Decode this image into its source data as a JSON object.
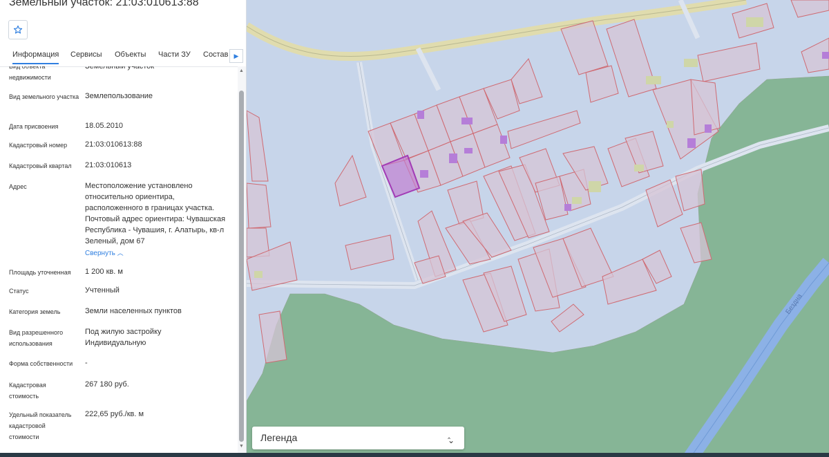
{
  "header": {
    "title": "Земельный участок: 21:03:010613:88"
  },
  "tabs": [
    {
      "label": "Информация",
      "active": true
    },
    {
      "label": "Сервисы"
    },
    {
      "label": "Объекты"
    },
    {
      "label": "Части ЗУ"
    },
    {
      "label": "Состав"
    }
  ],
  "info": {
    "object_type": {
      "label": "Вид объекта недвижимости",
      "value": "Земельный участок"
    },
    "land_type": {
      "label": "Вид земельного участка",
      "value": "Землепользование"
    },
    "assign_date": {
      "label": "Дата присвоения",
      "value": "18.05.2010"
    },
    "cad_number": {
      "label": "Кадастровый номер",
      "value": "21:03:010613:88"
    },
    "cad_quarter": {
      "label": "Кадастровый квартал",
      "value": "21:03:010613"
    },
    "address": {
      "label": "Адрес",
      "value": "Местоположение установлено относительно ориентира, расположенного в границах участка. Почтовый адрес ориентира: Чувашская Республика - Чувашия, г. Алатырь, кв-л Зеленый, дом 67",
      "collapse": "Свернуть"
    },
    "area": {
      "label": "Площадь уточненная",
      "value": "1 200 кв. м"
    },
    "status": {
      "label": "Статус",
      "value": "Учтенный"
    },
    "category": {
      "label": "Категория земель",
      "value": "Земли населенных пунктов"
    },
    "permitted_use": {
      "label": "Вид разрешенного использования",
      "value": "Под жилую застройку Индивидуальную"
    },
    "ownership": {
      "label": "Форма собственности",
      "value": "-"
    },
    "cad_value": {
      "label": "Кадастровая стоимость",
      "value": "267 180 руб."
    },
    "specific_value": {
      "label": "Удельный показатель кадастровой стоимости",
      "value": "222,65 руб./кв. м"
    }
  },
  "map": {
    "river_label": "Безднa",
    "legend_label": "Легенда"
  },
  "colors": {
    "accent": "#2f7fe0",
    "map_background": "#c7d5ea",
    "forest": "#86b596",
    "parcel_border": "#d16f76",
    "selected_parcel": "#a23bb5"
  }
}
